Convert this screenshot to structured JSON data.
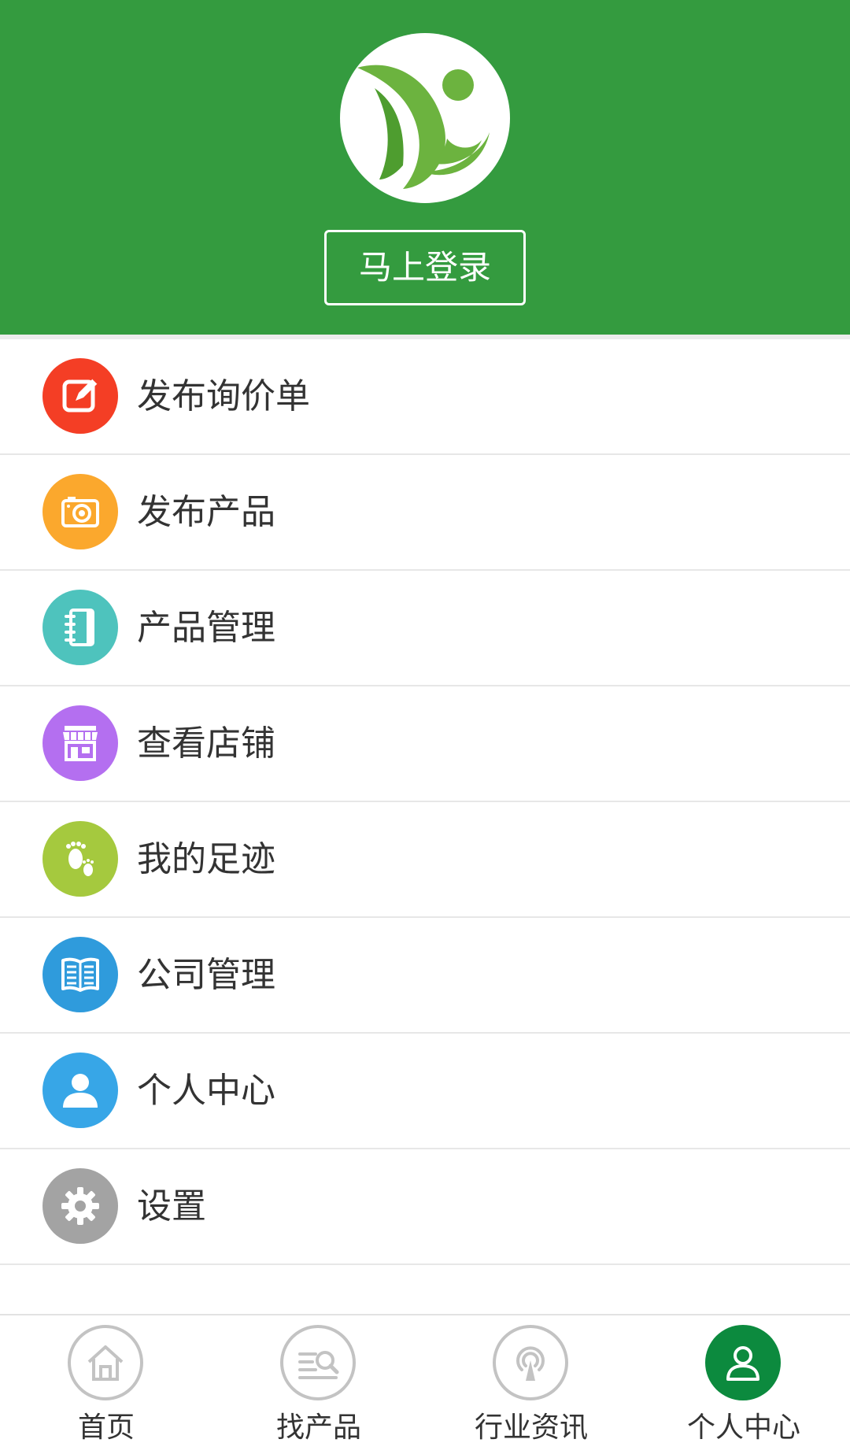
{
  "header": {
    "logo_icon": "leaf-person-logo",
    "login_label": "马上登录",
    "background_color": "#349b3f"
  },
  "menu": {
    "items": [
      {
        "label": "发布询价单",
        "icon": "edit-icon",
        "color": "#f43e25"
      },
      {
        "label": "发布产品",
        "icon": "camera-icon",
        "color": "#fba82d"
      },
      {
        "label": "产品管理",
        "icon": "notebook-icon",
        "color": "#4ec3bd"
      },
      {
        "label": "查看店铺",
        "icon": "store-icon",
        "color": "#b46ff0"
      },
      {
        "label": "我的足迹",
        "icon": "footprints-icon",
        "color": "#a5c93e"
      },
      {
        "label": "公司管理",
        "icon": "book-icon",
        "color": "#2f9bdc"
      },
      {
        "label": "个人中心",
        "icon": "user-icon",
        "color": "#37a6e7"
      },
      {
        "label": "设置",
        "icon": "gear-icon",
        "color": "#a3a3a3"
      }
    ]
  },
  "tabbar": {
    "tabs": [
      {
        "label": "首页",
        "icon": "home-icon",
        "active": false
      },
      {
        "label": "找产品",
        "icon": "search-list-icon",
        "active": false
      },
      {
        "label": "行业资讯",
        "icon": "broadcast-icon",
        "active": false
      },
      {
        "label": "个人中心",
        "icon": "user-icon",
        "active": true
      }
    ],
    "active_color": "#0c8a3e"
  }
}
